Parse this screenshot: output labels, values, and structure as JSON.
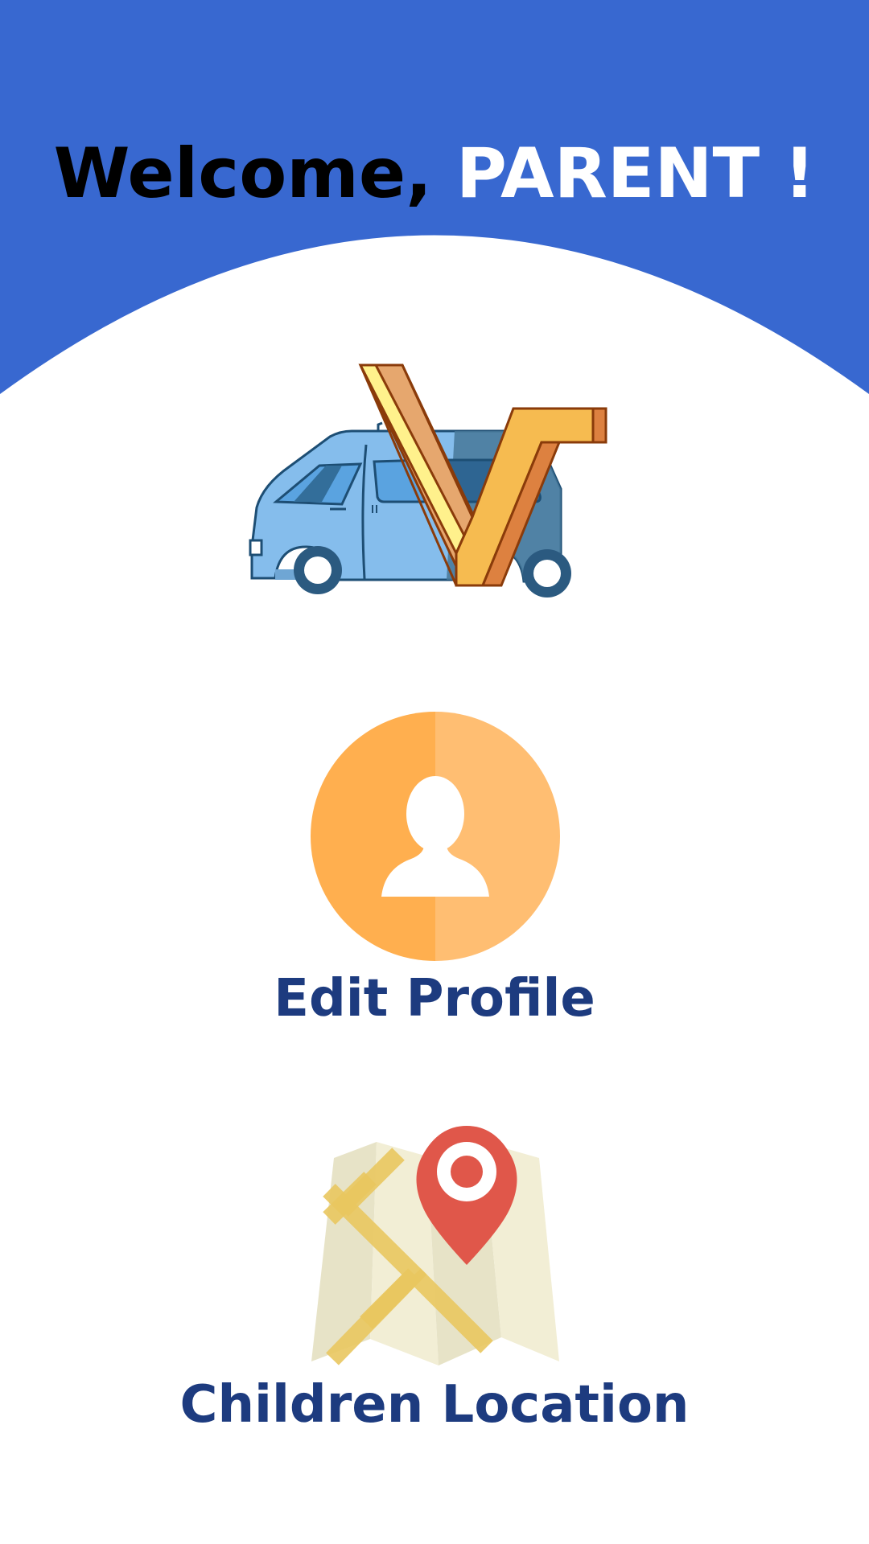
{
  "header": {
    "greeting": "Welcome,",
    "user_name": "PARENT !",
    "background_color": "#3868d0"
  },
  "logo": {
    "icon": "van-with-v-logo"
  },
  "menu": {
    "edit_profile": {
      "label": "Edit Profile",
      "icon": "user-avatar-icon"
    },
    "children_location": {
      "label": "Children Location",
      "icon": "map-pin-icon"
    }
  },
  "colors": {
    "label_text": "#1d3b7f",
    "avatar_orange": "#ffaf4f",
    "pin_red": "#e0574a"
  }
}
